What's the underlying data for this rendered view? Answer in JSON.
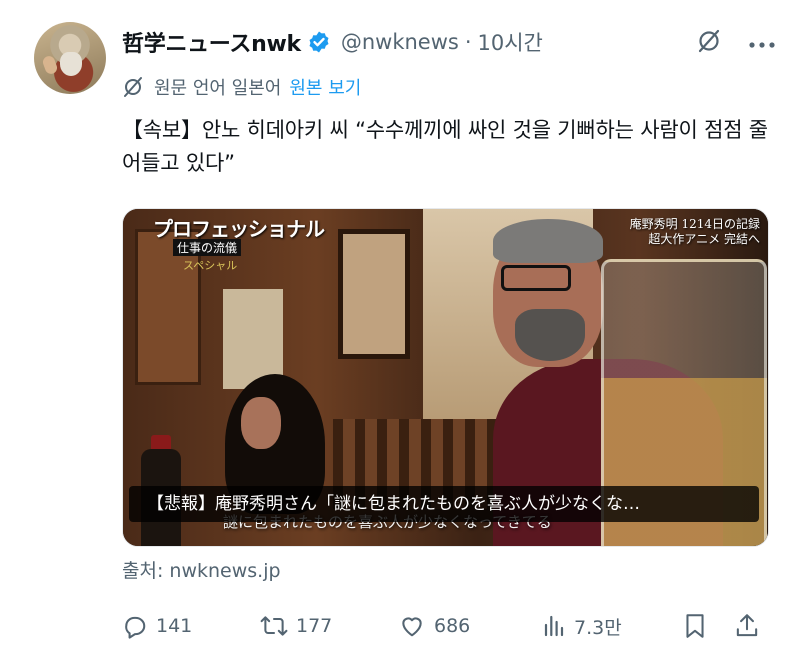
{
  "author": {
    "display_name": "哲学ニュースnwk",
    "handle": "@nwknews",
    "separator": "·",
    "time": "10시간",
    "verified_color": "#1d9bf0"
  },
  "translation": {
    "notice": "원문 언어 일본어",
    "link": "원본 보기"
  },
  "tweet": {
    "text": "【속보】안노 히데아키 씨 “수수께끼에 싸인 것을 기뻐하는 사람이 점점 줄어들고 있다”"
  },
  "media": {
    "logo_title": "プロフェッショナル",
    "logo_sub": "仕事の流儀",
    "logo_sub2": "スペシャル",
    "corner_line1": "庵野秀明 1214日の記録",
    "corner_line2": "超大作アニメ 完結へ",
    "caption": "【悲報】庵野秀明さん「謎に包まれたものを喜ぶ人が少なくな…",
    "subtitle": "謎に包まれたものを喜ぶ人が少なくなってきてる"
  },
  "source": "출처: nwknews.jp",
  "actions": {
    "replies": "141",
    "retweets": "177",
    "likes": "686",
    "views": "7.3만"
  },
  "icons": {
    "translate": "translate-slash-icon",
    "more": "more-dots-icon",
    "reply": "reply-icon",
    "retweet": "retweet-icon",
    "like": "heart-icon",
    "views": "views-bar-icon",
    "bookmark": "bookmark-icon",
    "share": "share-icon"
  },
  "colors": {
    "text": "#0f1419",
    "secondary": "#536471",
    "link": "#1d9bf0"
  }
}
